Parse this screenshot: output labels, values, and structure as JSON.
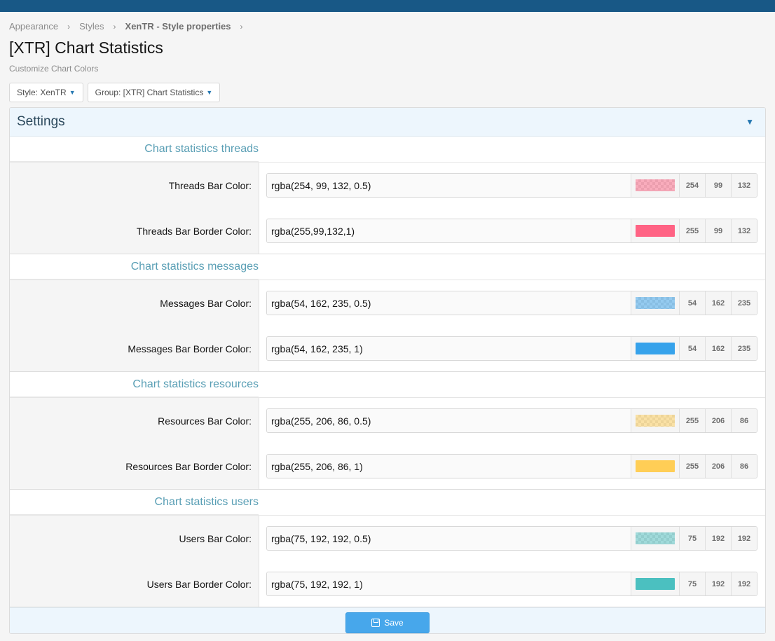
{
  "breadcrumb": [
    "Appearance",
    "Styles",
    "XenTR - Style properties"
  ],
  "breadcrumb_sep": "›",
  "page": {
    "title": "[XTR] Chart Statistics",
    "description": "Customize Chart Colors"
  },
  "filters": {
    "style": "Style: XenTR",
    "group": "Group: [XTR] Chart Statistics"
  },
  "settings": {
    "title": "Settings",
    "save_label": "Save"
  },
  "groups": [
    {
      "title": "Chart statistics threads",
      "fields": [
        {
          "label": "Threads Bar Color:",
          "value": "rgba(254, 99, 132, 0.5)",
          "color": "rgba(254, 99, 132, 0.5)",
          "alpha": true,
          "r": "254",
          "g": "99",
          "b": "132"
        },
        {
          "label": "Threads Bar Border Color:",
          "value": "rgba(255,99,132,1)",
          "color": "rgba(255,99,132,1)",
          "alpha": false,
          "r": "255",
          "g": "99",
          "b": "132"
        }
      ]
    },
    {
      "title": "Chart statistics messages",
      "fields": [
        {
          "label": "Messages Bar Color:",
          "value": "rgba(54, 162, 235, 0.5)",
          "color": "rgba(54, 162, 235, 0.5)",
          "alpha": true,
          "r": "54",
          "g": "162",
          "b": "235"
        },
        {
          "label": "Messages Bar Border Color:",
          "value": "rgba(54, 162, 235, 1)",
          "color": "rgba(54, 162, 235, 1)",
          "alpha": false,
          "r": "54",
          "g": "162",
          "b": "235"
        }
      ]
    },
    {
      "title": "Chart statistics resources",
      "fields": [
        {
          "label": "Resources Bar Color:",
          "value": "rgba(255, 206, 86, 0.5)",
          "color": "rgba(255, 206, 86, 0.5)",
          "alpha": true,
          "r": "255",
          "g": "206",
          "b": "86"
        },
        {
          "label": "Resources Bar Border Color:",
          "value": "rgba(255, 206, 86, 1)",
          "color": "rgba(255, 206, 86, 1)",
          "alpha": false,
          "r": "255",
          "g": "206",
          "b": "86"
        }
      ]
    },
    {
      "title": "Chart statistics users",
      "fields": [
        {
          "label": "Users Bar Color:",
          "value": "rgba(75, 192, 192, 0.5)",
          "color": "rgba(75, 192, 192, 0.5)",
          "alpha": true,
          "r": "75",
          "g": "192",
          "b": "192"
        },
        {
          "label": "Users Bar Border Color:",
          "value": "rgba(75, 192, 192, 1)",
          "color": "rgba(75, 192, 192, 1)",
          "alpha": false,
          "r": "75",
          "g": "192",
          "b": "192"
        }
      ]
    }
  ],
  "theme": {
    "topbar": "#185886",
    "accent": "#47a7eb",
    "group_title": "#5a9fb5"
  }
}
